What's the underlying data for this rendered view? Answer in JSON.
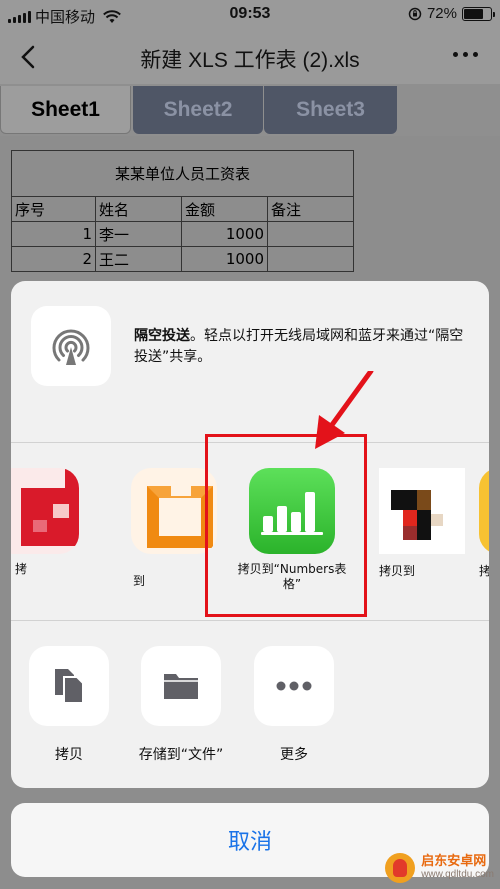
{
  "status_bar": {
    "carrier": "中国移动",
    "time": "09:53",
    "battery_percent": "72%",
    "battery_level": 0.72
  },
  "nav": {
    "title": "新建 XLS 工作表 (2).xls",
    "back_icon": "chevron-left-icon",
    "more_icon": "ellipsis-icon"
  },
  "tabs": [
    {
      "label": "Sheet1",
      "active": true
    },
    {
      "label": "Sheet2",
      "active": false
    },
    {
      "label": "Sheet3",
      "active": false
    }
  ],
  "sheet": {
    "title": "某某单位人员工资表",
    "headers": [
      "序号",
      "姓名",
      "金额",
      "备注"
    ],
    "rows": [
      [
        "1",
        "李一",
        "1000",
        ""
      ],
      [
        "2",
        "王二",
        "1000",
        ""
      ]
    ]
  },
  "share": {
    "airdrop_title": "隔空投送",
    "airdrop_desc": "。轻点以打开无线局域网和蓝牙来通过“隔空投送”共享。",
    "apps": [
      {
        "label": "拷",
        "icon": "red-app-icon"
      },
      {
        "label": "到",
        "icon": "orange-app-icon"
      },
      {
        "label": "拷贝到“Numbers表格”",
        "icon": "numbers-icon"
      },
      {
        "label": "拷贝到",
        "icon": "pixel-app-icon"
      },
      {
        "label": "拷",
        "icon": "yellow-app-icon"
      }
    ],
    "actions": [
      {
        "label": "拷贝",
        "icon": "copy-icon"
      },
      {
        "label": "存储到“文件”",
        "icon": "folder-icon"
      },
      {
        "label": "更多",
        "icon": "more-icon"
      }
    ],
    "cancel_label": "取消"
  },
  "watermark": {
    "name": "启东安卓网",
    "url": "www.qdltdu.com"
  },
  "colors": {
    "accent_blue": "#1a73e8",
    "highlight_red": "#e3121a",
    "numbers_green": "#34c038"
  }
}
